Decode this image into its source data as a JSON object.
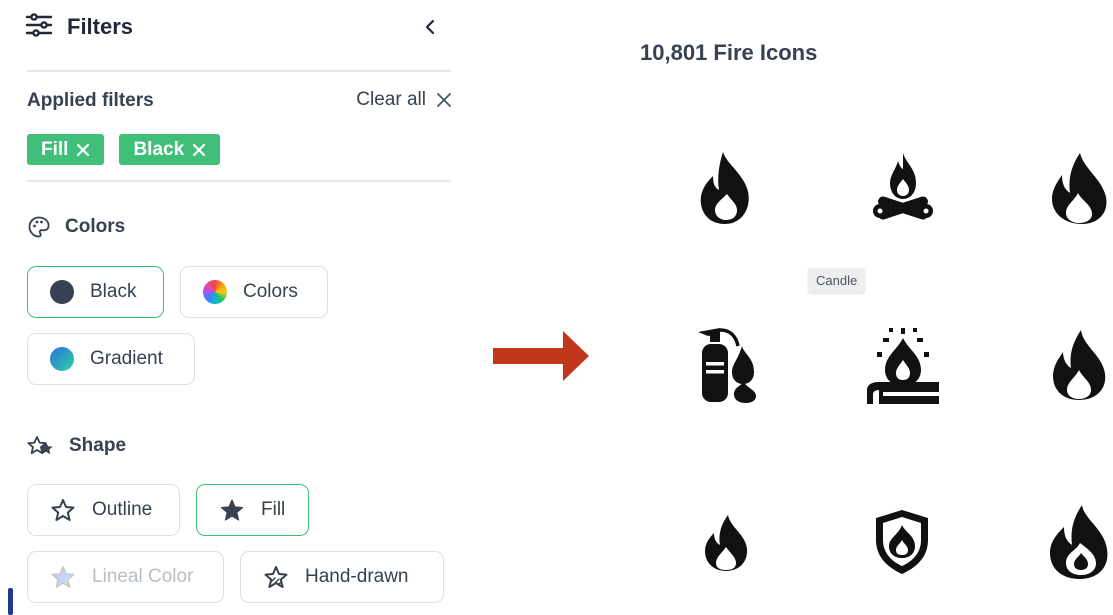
{
  "sidebar": {
    "title": "Filters",
    "applied": {
      "title": "Applied filters",
      "clear_label": "Clear all",
      "chips": [
        "Fill",
        "Black"
      ]
    },
    "colors": {
      "title": "Colors",
      "options": [
        {
          "label": "Black",
          "selected": true
        },
        {
          "label": "Colors",
          "selected": false
        },
        {
          "label": "Gradient",
          "selected": false
        }
      ]
    },
    "shape": {
      "title": "Shape",
      "options": [
        {
          "label": "Outline",
          "selected": false
        },
        {
          "label": "Fill",
          "selected": true
        },
        {
          "label": "Lineal Color",
          "selected": false,
          "disabled": true
        },
        {
          "label": "Hand-drawn",
          "selected": false
        }
      ]
    }
  },
  "main": {
    "results_title": "10,801 Fire Icons",
    "tooltip": "Candle",
    "icons": [
      "fire-icon",
      "campfire-icon",
      "flame-icon",
      "fire-extinguisher-icon",
      "candle-icon",
      "flame-icon",
      "flame-icon",
      "fire-shield-icon",
      "fire-icon"
    ]
  },
  "colors": {
    "accent": "#3fbf78",
    "arrow": "#c0371a",
    "text": "#374151"
  }
}
